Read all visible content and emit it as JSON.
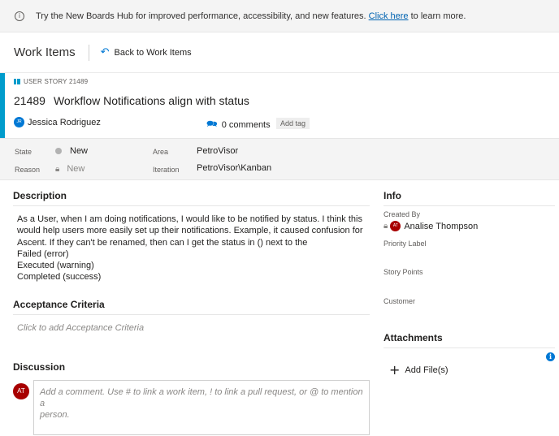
{
  "banner": {
    "text_before": "Try the New Boards Hub for improved performance, accessibility, and new features.",
    "link_text": "Click here",
    "text_after": "to learn more."
  },
  "header": {
    "title": "Work Items",
    "back_label": "Back to Work Items"
  },
  "work_item": {
    "type_label": "USER STORY 21489",
    "id": "21489",
    "title": "Workflow Notifications align with status",
    "assignee": {
      "initials": "JR",
      "name": "Jessica Rodriguez"
    },
    "comments_label": "0 comments",
    "add_tag_label": "Add tag",
    "accent_color": "#009ccc"
  },
  "fields": {
    "state_label": "State",
    "state_value": "New",
    "reason_label": "Reason",
    "reason_value": "New",
    "area_label": "Area",
    "area_value": "PetroVisor",
    "iteration_label": "Iteration",
    "iteration_value": "PetroVisor\\Kanban"
  },
  "description": {
    "heading": "Description",
    "lines": [
      "As a User, when I am doing notifications, I would like to be notified by status.   I think this",
      "would help users more easily set up their notifications.  Example, it caused confusion for",
      "Ascent. If they can't be renamed, then can I get the status in () next to the",
      "Failed (error)",
      "Executed (warning)",
      "Completed (success)"
    ]
  },
  "acceptance": {
    "heading": "Acceptance Criteria",
    "placeholder": "Click to add Acceptance Criteria"
  },
  "discussion": {
    "heading": "Discussion",
    "avatar_initials": "AT",
    "placeholder_line1": "Add a comment. Use # to link a work item, ! to link a pull request, or @ to mention a",
    "placeholder_line2": "person."
  },
  "info": {
    "heading": "Info",
    "created_by_label": "Created By",
    "created_by": {
      "initials": "AT",
      "name": "Analise Thompson"
    },
    "priority_label": "Priority Label",
    "story_points_label": "Story Points",
    "customer_label": "Customer"
  },
  "attachments": {
    "heading": "Attachments",
    "add_file_label": "Add File(s)"
  }
}
